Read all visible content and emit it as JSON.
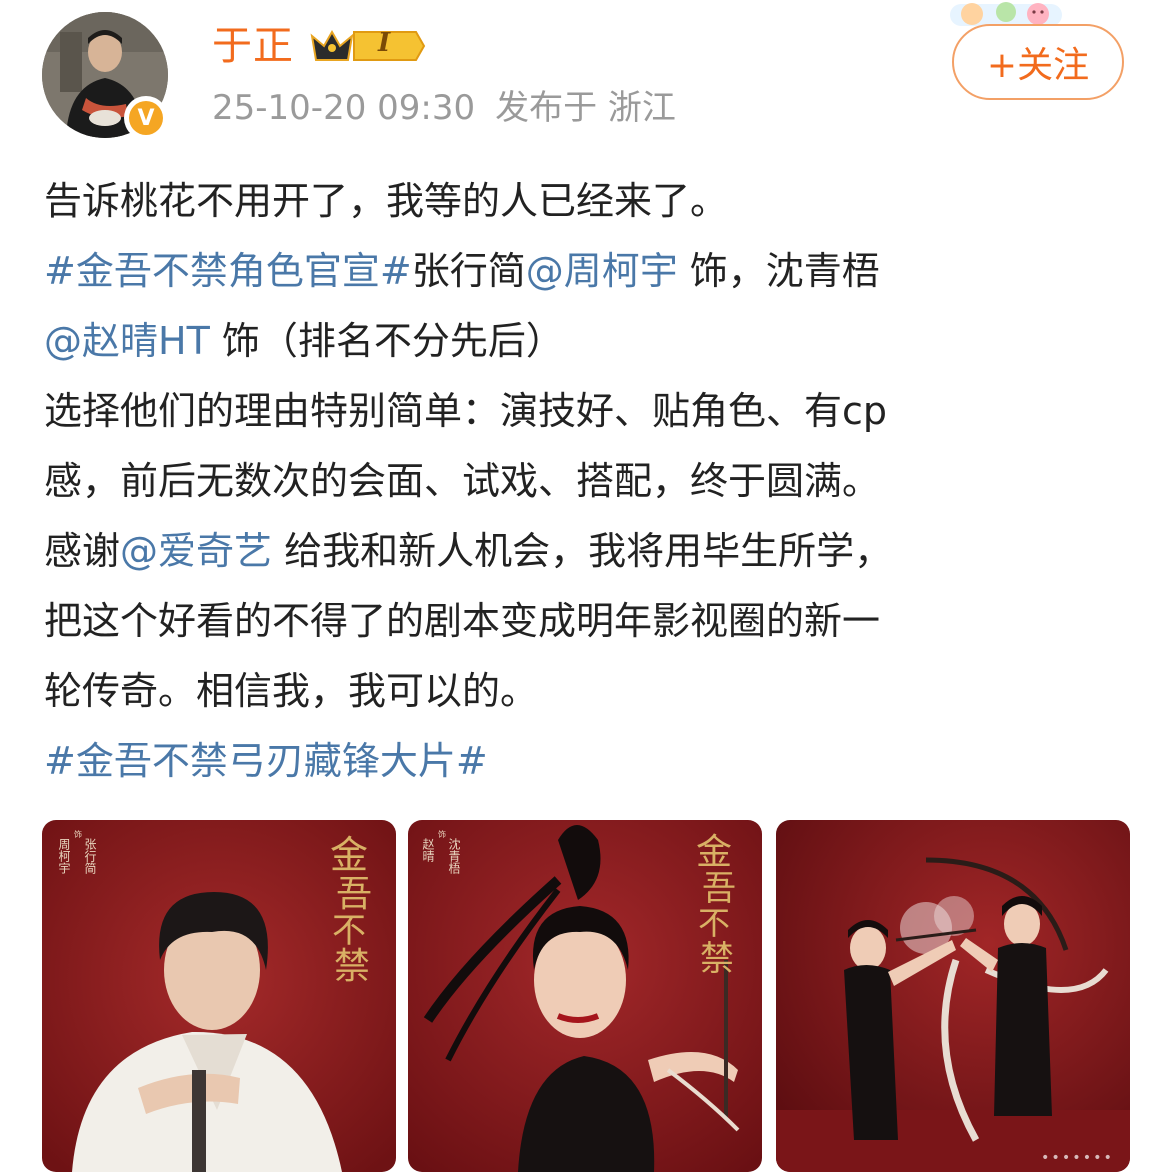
{
  "user": {
    "name": "于正",
    "verified_mark": "V",
    "vip_level": "I",
    "post_time": "25-10-20 09:30",
    "location": "发布于 浙江"
  },
  "follow_button": {
    "label": "+关注"
  },
  "post": {
    "line1": "告诉桃花不用开了，我等的人已经来了。",
    "line2": {
      "hashtag": "#金吾不禁角色官宣#",
      "text1": "张行简",
      "mention": "@周柯宇",
      "text2": " 饰，沈青梧"
    },
    "line3": {
      "mention": "@赵晴HT",
      "text": " 饰（排名不分先后）"
    },
    "line4": "选择他们的理由特别简单：演技好、贴角色、有cp",
    "line5": "感，前后无数次的会面、试戏、搭配，终于圆满。",
    "line6": {
      "text1": "感谢",
      "mention": "@爱奇艺",
      "text2": " 给我和新人机会，我将用毕生所学，"
    },
    "line7": "把这个好看的不得了的剧本变成明年影视圈的新一",
    "line8": "轮传奇。相信我，我可以的。",
    "line9": {
      "hashtag": "#金吾不禁弓刃藏锋大片#"
    }
  },
  "images": [
    {
      "title_chars": [
        "金",
        "吾",
        "不",
        "禁"
      ],
      "credit_role": "张行简",
      "credit_shi": "饰",
      "credit_actor": "周柯宇"
    },
    {
      "title_chars": [
        "金",
        "吾",
        "不",
        "禁"
      ],
      "credit_role": "沈青梧",
      "credit_shi": "饰",
      "credit_actor": "赵晴"
    },
    {}
  ],
  "watermark": "•••••••",
  "colors": {
    "accent_orange": "#f26b1d",
    "link_blue": "#4a78a8",
    "meta_gray": "#9a9a9a",
    "poster_red": "#8e1a1c"
  }
}
